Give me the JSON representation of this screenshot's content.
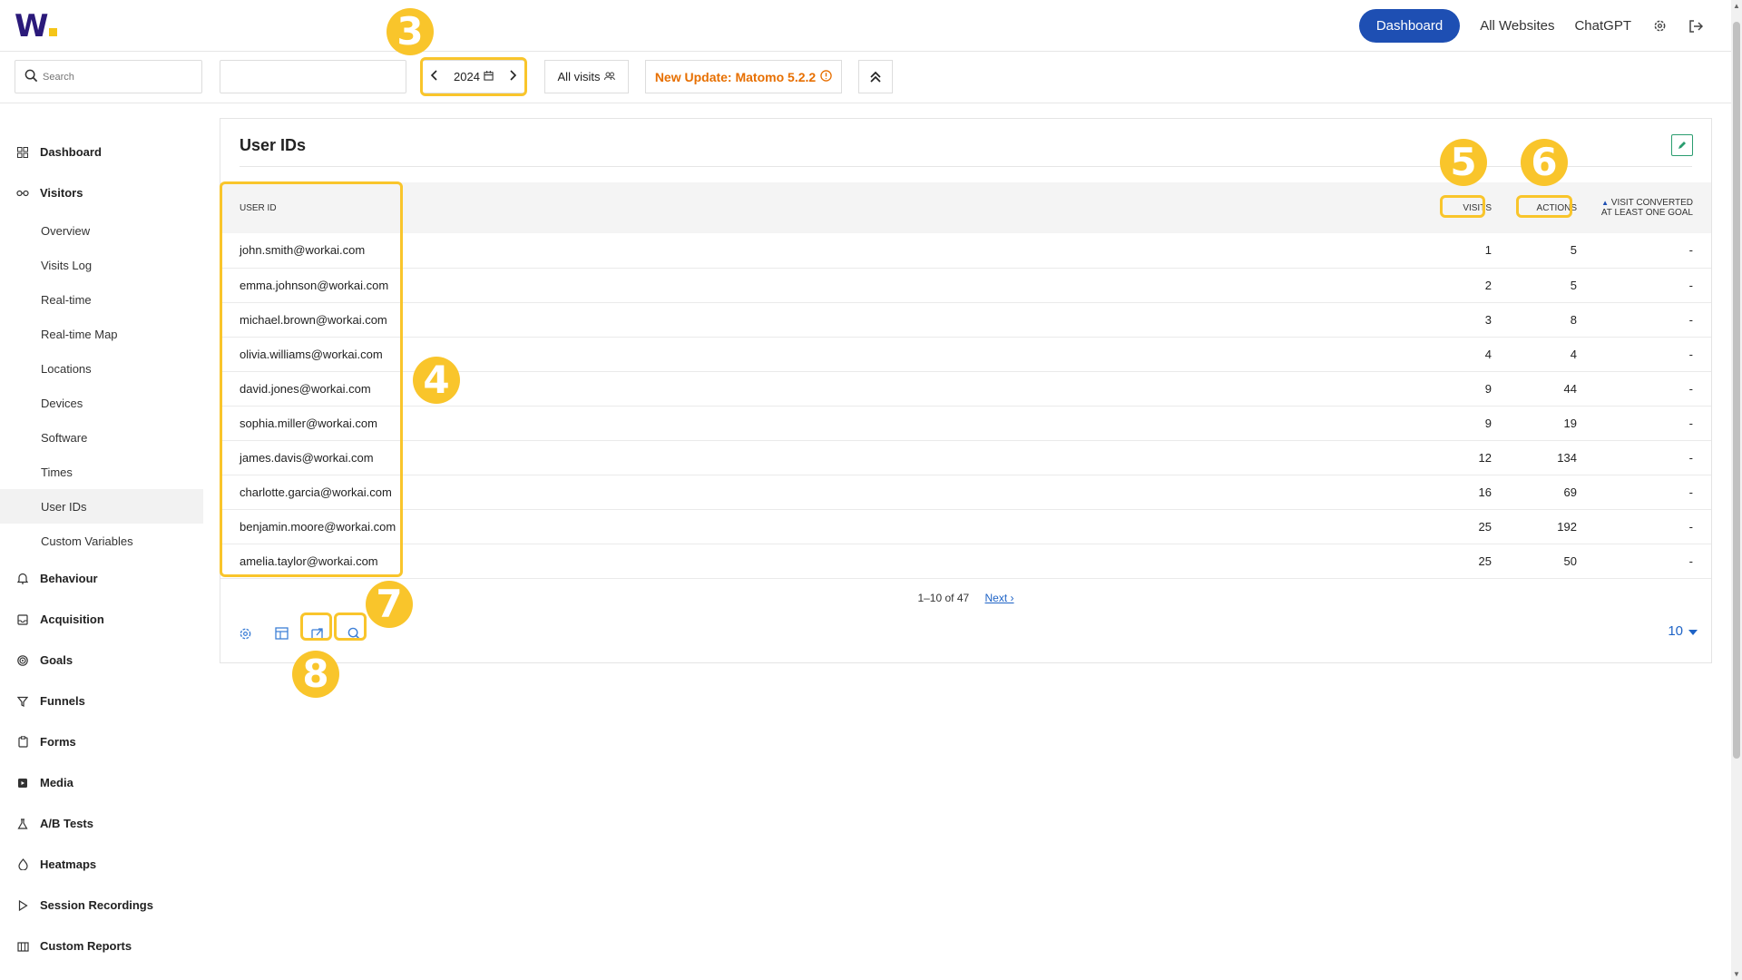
{
  "app": {
    "logo_text": "W",
    "colors": {
      "brand": "#2b1a7a",
      "accent": "#1e4fb3",
      "highlight": "#f9c52b",
      "update": "#e76f00"
    }
  },
  "topnav": {
    "dashboard": "Dashboard",
    "all_websites": "All Websites",
    "chatgpt": "ChatGPT",
    "settings_icon": "gear-icon",
    "logout_icon": "logout-icon"
  },
  "toolbar": {
    "search_placeholder": "Search",
    "period": "2024",
    "segment": "All visits",
    "update": "New Update: Matomo 5.2.2"
  },
  "sidebar": {
    "sections": [
      {
        "label": "Dashboard",
        "icon": "grid-icon"
      },
      {
        "label": "Visitors",
        "icon": "glasses-icon"
      }
    ],
    "visitor_items": [
      "Overview",
      "Visits Log",
      "Real-time",
      "Real-time Map",
      "Locations",
      "Devices",
      "Software",
      "Times",
      "User IDs",
      "Custom Variables"
    ],
    "active_item": "User IDs",
    "more_sections": [
      {
        "label": "Behaviour",
        "icon": "bell-icon"
      },
      {
        "label": "Acquisition",
        "icon": "inbox-icon"
      },
      {
        "label": "Goals",
        "icon": "target-icon"
      },
      {
        "label": "Funnels",
        "icon": "funnel-icon"
      },
      {
        "label": "Forms",
        "icon": "clipboard-icon"
      },
      {
        "label": "Media",
        "icon": "media-icon"
      },
      {
        "label": "A/B Tests",
        "icon": "flask-icon"
      },
      {
        "label": "Heatmaps",
        "icon": "heatmap-icon"
      },
      {
        "label": "Session Recordings",
        "icon": "play-icon"
      },
      {
        "label": "Custom Reports",
        "icon": "report-icon"
      }
    ]
  },
  "report": {
    "title": "User IDs",
    "columns": {
      "user_id": "USER ID",
      "visits": "VISITS",
      "actions": "ACTIONS",
      "goal_line1": "VISIT CONVERTED",
      "goal_line2": "AT LEAST ONE GOAL"
    },
    "rows": [
      {
        "user": "john.smith@workai.com",
        "visits": "1",
        "actions": "5",
        "goal": "-"
      },
      {
        "user": "emma.johnson@workai.com",
        "visits": "2",
        "actions": "5",
        "goal": "-"
      },
      {
        "user": "michael.brown@workai.com",
        "visits": "3",
        "actions": "8",
        "goal": "-"
      },
      {
        "user": "olivia.williams@workai.com",
        "visits": "4",
        "actions": "4",
        "goal": "-"
      },
      {
        "user": "david.jones@workai.com",
        "visits": "9",
        "actions": "44",
        "goal": "-"
      },
      {
        "user": "sophia.miller@workai.com",
        "visits": "9",
        "actions": "19",
        "goal": "-"
      },
      {
        "user": "james.davis@workai.com",
        "visits": "12",
        "actions": "134",
        "goal": "-"
      },
      {
        "user": "charlotte.garcia@workai.com",
        "visits": "16",
        "actions": "69",
        "goal": "-"
      },
      {
        "user": "benjamin.moore@workai.com",
        "visits": "25",
        "actions": "192",
        "goal": "-"
      },
      {
        "user": "amelia.taylor@workai.com",
        "visits": "25",
        "actions": "50",
        "goal": "-"
      }
    ],
    "pagination": "1–10 of 47",
    "next": "Next ›",
    "limit": "10"
  },
  "callouts": [
    "3",
    "4",
    "5",
    "6",
    "7",
    "8"
  ]
}
